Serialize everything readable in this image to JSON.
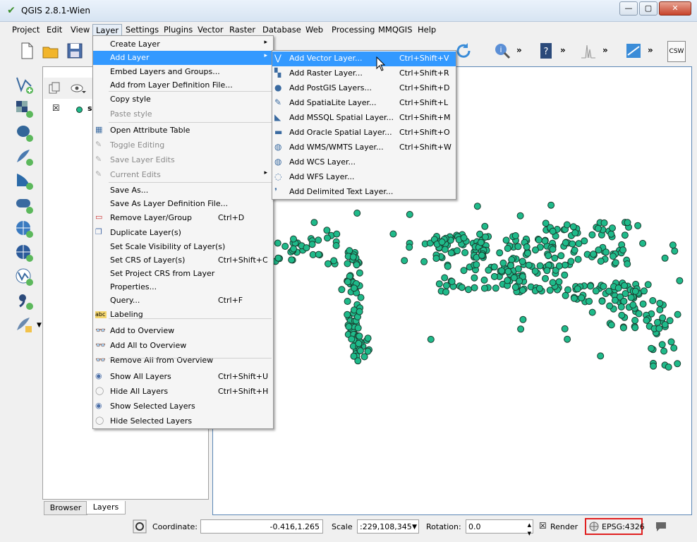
{
  "app_title": "QGIS 2.8.1-Wien",
  "window_buttons": {
    "minimize": "—",
    "maximize": "▢",
    "close": "✕"
  },
  "menubar": [
    "Project",
    "Edit",
    "View",
    "Layer",
    "Settings",
    "Plugins",
    "Vector",
    "Raster",
    "Database",
    "Web",
    "Processing",
    "MMQGIS",
    "Help"
  ],
  "layer_menu": [
    {
      "label": "Create Layer",
      "arrow": "▸"
    },
    {
      "label": "Add Layer",
      "arrow": "▸"
    },
    {
      "label": "Embed Layers and Groups..."
    },
    {
      "label": "Add from Layer Definition File..."
    },
    {
      "label": "Copy style"
    },
    {
      "label": "Paste style"
    },
    {
      "label": "Open Attribute Table"
    },
    {
      "label": "Toggle Editing"
    },
    {
      "label": "Save Layer Edits"
    },
    {
      "label": "Current Edits",
      "arrow": "▸"
    },
    {
      "label": "Save As..."
    },
    {
      "label": "Save As Layer Definition File..."
    },
    {
      "label": "Remove Layer/Group",
      "shortcut": "Ctrl+D"
    },
    {
      "label": "Duplicate Layer(s)"
    },
    {
      "label": "Set Scale Visibility of Layer(s)"
    },
    {
      "label": "Set CRS of Layer(s)",
      "shortcut": "Ctrl+Shift+C"
    },
    {
      "label": "Set Project CRS from Layer"
    },
    {
      "label": "Properties..."
    },
    {
      "label": "Query...",
      "shortcut": "Ctrl+F"
    },
    {
      "label": "Labeling"
    },
    {
      "label": "Add to Overview"
    },
    {
      "label": "Add All to Overview"
    },
    {
      "label": "Remove All from Overview"
    },
    {
      "label": "Show All Layers",
      "shortcut": "Ctrl+Shift+U"
    },
    {
      "label": "Hide All Layers",
      "shortcut": "Ctrl+Shift+H"
    },
    {
      "label": "Show Selected Layers"
    },
    {
      "label": "Hide Selected Layers"
    }
  ],
  "add_layer_menu": [
    {
      "label": "Add Vector Layer...",
      "shortcut": "Ctrl+Shift+V"
    },
    {
      "label": "Add Raster Layer...",
      "shortcut": "Ctrl+Shift+R"
    },
    {
      "label": "Add PostGIS Layers...",
      "shortcut": "Ctrl+Shift+D"
    },
    {
      "label": "Add SpatiaLite Layer...",
      "shortcut": "Ctrl+Shift+L"
    },
    {
      "label": "Add MSSQL Spatial Layer...",
      "shortcut": "Ctrl+Shift+M"
    },
    {
      "label": "Add Oracle Spatial Layer...",
      "shortcut": "Ctrl+Shift+O"
    },
    {
      "label": "Add WMS/WMTS Layer...",
      "shortcut": "Ctrl+Shift+W"
    },
    {
      "label": "Add WCS Layer..."
    },
    {
      "label": "Add WFS Layer..."
    },
    {
      "label": "Add Delimited Text Layer..."
    }
  ],
  "toolbar": {
    "csw_label": "CSW",
    "more": "»"
  },
  "labeling_badge": "abc",
  "layers_panel": {
    "layer_name_partial": "s"
  },
  "tabs": {
    "browser": "Browser",
    "layers": "Layers"
  },
  "statusbar": {
    "coordinate_label": "Coordinate:",
    "coordinate_value": "-0.416,1.265",
    "scale_label": "Scale",
    "scale_value": ":229,108,345",
    "rotation_label": "Rotation:",
    "rotation_value": "0.0",
    "render_label": "Render",
    "crs": "EPSG:4326"
  },
  "colors": {
    "point_fill": "#1fba8a",
    "point_stroke": "#1a3b2e",
    "highlight": "#3399ff",
    "epsg_border": "#e02020"
  }
}
